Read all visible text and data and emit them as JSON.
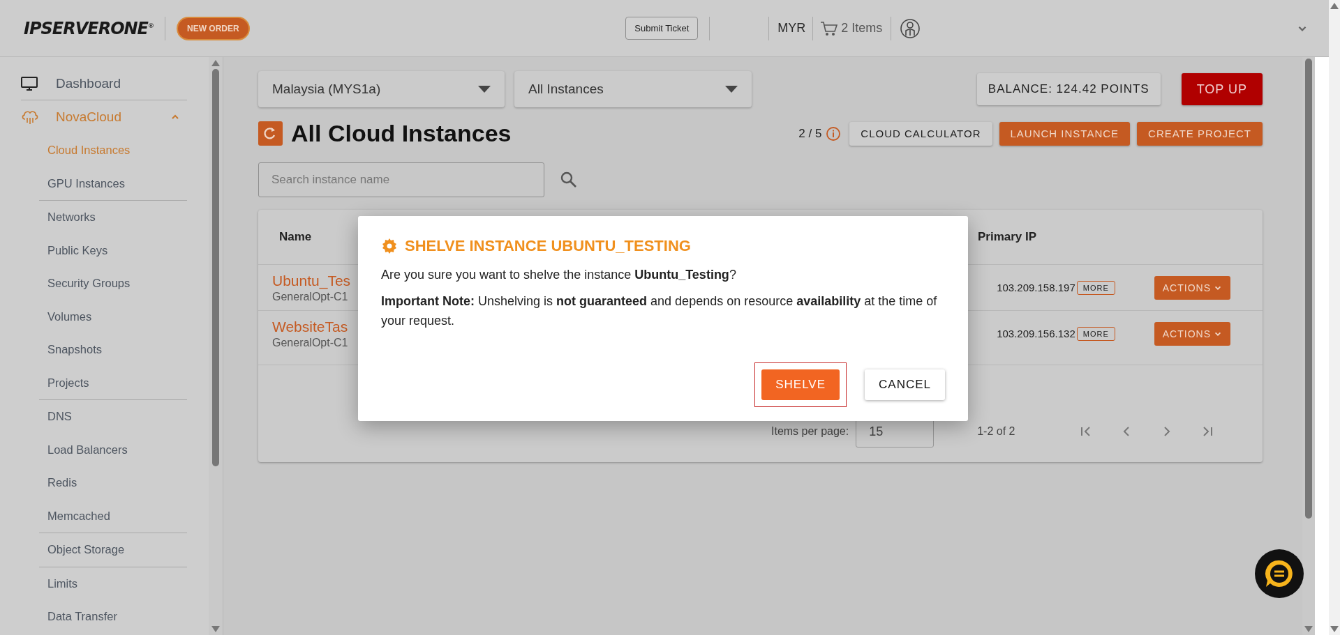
{
  "header": {
    "logo": "IPSERVERONE$^{®}$",
    "new_order": "NEW ORDER",
    "submit_ticket": "Submit Ticket",
    "currency": "MYR",
    "cart": "2 Items"
  },
  "sidebar": {
    "items": [
      {
        "label": "Dashboard",
        "kind": "dashboard",
        "selected": false
      },
      {
        "label": "NovaCloud",
        "kind": "cloud",
        "selected": true,
        "expanded": true,
        "groups": [
          [
            {
              "label": "Cloud Instances",
              "selected": true
            },
            {
              "label": "GPU Instances",
              "selected": false
            }
          ],
          [
            {
              "label": "Networks",
              "selected": false
            },
            {
              "label": "Public Keys",
              "selected": false
            },
            {
              "label": "Security Groups",
              "selected": false
            },
            {
              "label": "Volumes",
              "selected": false
            },
            {
              "label": "Snapshots",
              "selected": false
            },
            {
              "label": "Projects",
              "selected": false
            }
          ],
          [
            {
              "label": "DNS",
              "selected": false
            },
            {
              "label": "Load Balancers",
              "selected": false
            },
            {
              "label": "Redis",
              "selected": false
            },
            {
              "label": "Memcached",
              "selected": false
            }
          ],
          [
            {
              "label": "Object Storage",
              "selected": false
            }
          ],
          [
            {
              "label": "Limits",
              "selected": false
            },
            {
              "label": "Data Transfer",
              "selected": false
            }
          ]
        ]
      }
    ]
  },
  "filters": {
    "region": "Malaysia (MYS1a)",
    "scope": "All Instances"
  },
  "balance": "BALANCE: 124.42 POINTS",
  "top_up": "TOP UP",
  "page_title": "All Cloud Instances",
  "quota": "2 / 5",
  "actions": [
    "CLOUD CALCULATOR",
    "LAUNCH INSTANCE",
    "CREATE PROJECT"
  ],
  "search": {
    "placeholder": "Search instance name"
  },
  "table": {
    "columns": [
      "Name",
      "Primary IP"
    ],
    "rows": [
      {
        "name": "Ubuntu_Tes",
        "flavor": "GeneralOpt-C1",
        "ip": "103.209.158.197",
        "more": "MORE",
        "actions": "ACTIONS"
      },
      {
        "name": "WebsiteTas",
        "flavor": "GeneralOpt-C1",
        "ip": "103.209.156.132",
        "more": "MORE",
        "actions": "ACTIONS"
      }
    ]
  },
  "pagination": {
    "items_per_page_label": "Items per page:",
    "items_per_page": "15",
    "range": "1-2 of 2"
  },
  "dialog": {
    "title": "SHELVE INSTANCE UBUNTU_TESTING",
    "question": "Are you sure you want to shelve the instance **Ubuntu_Testing**?",
    "note": "**Important Note:** Unshelving is **not guaranteed** and depends on resource **availability** at the time of your request.",
    "buttons": [
      {
        "label": "SHELVE",
        "kind": "primary",
        "focused": true
      },
      {
        "label": "CANCEL",
        "kind": "secondary",
        "focused": false
      }
    ]
  }
}
